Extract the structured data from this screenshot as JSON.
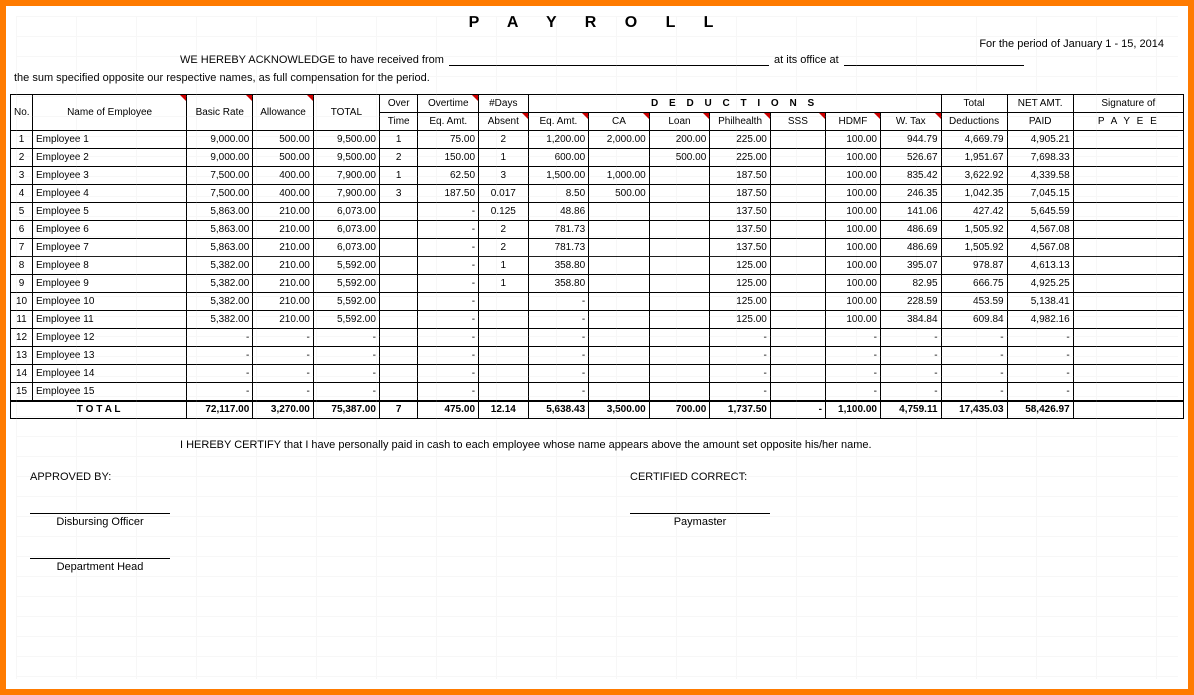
{
  "header": {
    "title": "P A Y R O L L",
    "period_label": "For the period of",
    "period_value": "January 1 - 15,  2014",
    "ack_prefix": "WE HEREBY ACKNOWLEDGE to have received from",
    "ack_mid": "at its office at",
    "sum_line": "the sum specified opposite our respective names, as full compensation for the period."
  },
  "cols": {
    "no": "No.",
    "name": "Name of Employee",
    "basic": "Basic Rate",
    "allow": "Allowance",
    "total": "TOTAL",
    "ot": "Over",
    "ot2": "Time",
    "oteq": "Overtime",
    "oteq2": "Eq. Amt.",
    "days": "#Days",
    "days2": "Absent",
    "ded": "D  E  D  U  C  T  I  O  N  S",
    "eqamt": "Eq. Amt.",
    "ca": "CA",
    "loan": "Loan",
    "phil": "Philhealth",
    "sss": "SSS",
    "hdmf": "HDMF",
    "wtax": "W. Tax",
    "totded": "Total",
    "totded2": "Deductions",
    "net": "NET AMT.",
    "net2": "PAID",
    "sig": "Signature of",
    "sig2": "P A Y E E"
  },
  "rows": [
    {
      "no": 1,
      "name": "Employee 1",
      "basic": "9,000.00",
      "allow": "500.00",
      "total": "9,500.00",
      "ot": "1",
      "oteq": "75.00",
      "days": "2",
      "eqamt": "1,200.00",
      "ca": "2,000.00",
      "loan": "200.00",
      "phil": "225.00",
      "sss": "",
      "hdmf": "100.00",
      "wtax": "944.79",
      "totded": "4,669.79",
      "net": "4,905.21"
    },
    {
      "no": 2,
      "name": "Employee 2",
      "basic": "9,000.00",
      "allow": "500.00",
      "total": "9,500.00",
      "ot": "2",
      "oteq": "150.00",
      "days": "1",
      "eqamt": "600.00",
      "ca": "",
      "loan": "500.00",
      "phil": "225.00",
      "sss": "",
      "hdmf": "100.00",
      "wtax": "526.67",
      "totded": "1,951.67",
      "net": "7,698.33"
    },
    {
      "no": 3,
      "name": "Employee 3",
      "basic": "7,500.00",
      "allow": "400.00",
      "total": "7,900.00",
      "ot": "1",
      "oteq": "62.50",
      "days": "3",
      "eqamt": "1,500.00",
      "ca": "1,000.00",
      "loan": "",
      "phil": "187.50",
      "sss": "",
      "hdmf": "100.00",
      "wtax": "835.42",
      "totded": "3,622.92",
      "net": "4,339.58"
    },
    {
      "no": 4,
      "name": "Employee 4",
      "basic": "7,500.00",
      "allow": "400.00",
      "total": "7,900.00",
      "ot": "3",
      "oteq": "187.50",
      "days": "0.017",
      "eqamt": "8.50",
      "ca": "500.00",
      "loan": "",
      "phil": "187.50",
      "sss": "",
      "hdmf": "100.00",
      "wtax": "246.35",
      "totded": "1,042.35",
      "net": "7,045.15"
    },
    {
      "no": 5,
      "name": "Employee 5",
      "basic": "5,863.00",
      "allow": "210.00",
      "total": "6,073.00",
      "ot": "",
      "oteq": "-",
      "days": "0.125",
      "eqamt": "48.86",
      "ca": "",
      "loan": "",
      "phil": "137.50",
      "sss": "",
      "hdmf": "100.00",
      "wtax": "141.06",
      "totded": "427.42",
      "net": "5,645.59"
    },
    {
      "no": 6,
      "name": "Employee 6",
      "basic": "5,863.00",
      "allow": "210.00",
      "total": "6,073.00",
      "ot": "",
      "oteq": "-",
      "days": "2",
      "eqamt": "781.73",
      "ca": "",
      "loan": "",
      "phil": "137.50",
      "sss": "",
      "hdmf": "100.00",
      "wtax": "486.69",
      "totded": "1,505.92",
      "net": "4,567.08"
    },
    {
      "no": 7,
      "name": "Employee 7",
      "basic": "5,863.00",
      "allow": "210.00",
      "total": "6,073.00",
      "ot": "",
      "oteq": "-",
      "days": "2",
      "eqamt": "781.73",
      "ca": "",
      "loan": "",
      "phil": "137.50",
      "sss": "",
      "hdmf": "100.00",
      "wtax": "486.69",
      "totded": "1,505.92",
      "net": "4,567.08"
    },
    {
      "no": 8,
      "name": "Employee 8",
      "basic": "5,382.00",
      "allow": "210.00",
      "total": "5,592.00",
      "ot": "",
      "oteq": "-",
      "days": "1",
      "eqamt": "358.80",
      "ca": "",
      "loan": "",
      "phil": "125.00",
      "sss": "",
      "hdmf": "100.00",
      "wtax": "395.07",
      "totded": "978.87",
      "net": "4,613.13"
    },
    {
      "no": 9,
      "name": "Employee 9",
      "basic": "5,382.00",
      "allow": "210.00",
      "total": "5,592.00",
      "ot": "",
      "oteq": "-",
      "days": "1",
      "eqamt": "358.80",
      "ca": "",
      "loan": "",
      "phil": "125.00",
      "sss": "",
      "hdmf": "100.00",
      "wtax": "82.95",
      "totded": "666.75",
      "net": "4,925.25"
    },
    {
      "no": 10,
      "name": "Employee 10",
      "basic": "5,382.00",
      "allow": "210.00",
      "total": "5,592.00",
      "ot": "",
      "oteq": "-",
      "days": "",
      "eqamt": "-",
      "ca": "",
      "loan": "",
      "phil": "125.00",
      "sss": "",
      "hdmf": "100.00",
      "wtax": "228.59",
      "totded": "453.59",
      "net": "5,138.41"
    },
    {
      "no": 11,
      "name": "Employee 11",
      "basic": "5,382.00",
      "allow": "210.00",
      "total": "5,592.00",
      "ot": "",
      "oteq": "-",
      "days": "",
      "eqamt": "-",
      "ca": "",
      "loan": "",
      "phil": "125.00",
      "sss": "",
      "hdmf": "100.00",
      "wtax": "384.84",
      "totded": "609.84",
      "net": "4,982.16"
    },
    {
      "no": 12,
      "name": "Employee 12",
      "basic": "-",
      "allow": "-",
      "total": "-",
      "ot": "",
      "oteq": "-",
      "days": "",
      "eqamt": "-",
      "ca": "",
      "loan": "",
      "phil": "-",
      "sss": "",
      "hdmf": "-",
      "wtax": "-",
      "totded": "-",
      "net": "-"
    },
    {
      "no": 13,
      "name": "Employee 13",
      "basic": "-",
      "allow": "-",
      "total": "-",
      "ot": "",
      "oteq": "-",
      "days": "",
      "eqamt": "-",
      "ca": "",
      "loan": "",
      "phil": "-",
      "sss": "",
      "hdmf": "-",
      "wtax": "-",
      "totded": "-",
      "net": "-"
    },
    {
      "no": 14,
      "name": "Employee 14",
      "basic": "-",
      "allow": "-",
      "total": "-",
      "ot": "",
      "oteq": "-",
      "days": "",
      "eqamt": "-",
      "ca": "",
      "loan": "",
      "phil": "-",
      "sss": "",
      "hdmf": "-",
      "wtax": "-",
      "totded": "-",
      "net": "-"
    },
    {
      "no": 15,
      "name": "Employee 15",
      "basic": "-",
      "allow": "-",
      "total": "-",
      "ot": "",
      "oteq": "-",
      "days": "",
      "eqamt": "-",
      "ca": "",
      "loan": "",
      "phil": "-",
      "sss": "",
      "hdmf": "-",
      "wtax": "-",
      "totded": "-",
      "net": "-"
    }
  ],
  "totals": {
    "label": "T O T A L",
    "basic": "72,117.00",
    "allow": "3,270.00",
    "total": "75,387.00",
    "ot": "7",
    "oteq": "475.00",
    "days": "12.14",
    "eqamt": "5,638.43",
    "ca": "3,500.00",
    "loan": "700.00",
    "phil": "1,737.50",
    "sss": "-",
    "hdmf": "1,100.00",
    "wtax": "4,759.11",
    "totded": "17,435.03",
    "net": "58,426.97"
  },
  "footer": {
    "certify": "I HEREBY CERTIFY  that I have personally paid in cash to each employee whose name appears above the amount set opposite his/her name.",
    "approved": "APPROVED BY:",
    "certified": "CERTIFIED CORRECT:",
    "disb": "Disbursing Officer",
    "paym": "Paymaster",
    "dept": "Department Head"
  }
}
